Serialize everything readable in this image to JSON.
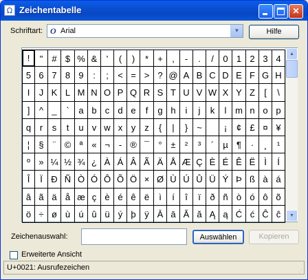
{
  "window": {
    "title": "Zeichentabelle",
    "title_icon": "charmap-icon",
    "controls": [
      "minimize",
      "maximize",
      "close"
    ]
  },
  "font": {
    "label": "Schriftart:",
    "value": "Arial",
    "type_icon": "opentype-icon"
  },
  "help_button": "Hilfe",
  "grid": {
    "rows": [
      [
        "!",
        "\"",
        "#",
        "$",
        "%",
        "&",
        "'",
        "(",
        ")",
        "*",
        "+",
        ",",
        "-",
        ".",
        "/",
        "0",
        "1",
        "2",
        "3",
        "4"
      ],
      [
        "5",
        "6",
        "7",
        "8",
        "9",
        ":",
        ";",
        "<",
        "=",
        ">",
        "?",
        "@",
        "A",
        "B",
        "C",
        "D",
        "E",
        "F",
        "G",
        "H"
      ],
      [
        "I",
        "J",
        "K",
        "L",
        "M",
        "N",
        "O",
        "P",
        "Q",
        "R",
        "S",
        "T",
        "U",
        "V",
        "W",
        "X",
        "Y",
        "Z",
        "[",
        "\\"
      ],
      [
        "]",
        "^",
        "_",
        "`",
        "a",
        "b",
        "c",
        "d",
        "e",
        "f",
        "g",
        "h",
        "i",
        "j",
        "k",
        "l",
        "m",
        "n",
        "o",
        "p"
      ],
      [
        "q",
        "r",
        "s",
        "t",
        "u",
        "v",
        "w",
        "x",
        "y",
        "z",
        "{",
        "|",
        "}",
        "~",
        " ",
        "¡",
        "¢",
        "£",
        "¤",
        "¥"
      ],
      [
        "¦",
        "§",
        "¨",
        "©",
        "ª",
        "«",
        "¬",
        "-",
        "®",
        "¯",
        "°",
        "±",
        "²",
        "³",
        "´",
        "µ",
        "¶",
        "·",
        "¸",
        "¹"
      ],
      [
        "º",
        "»",
        "¼",
        "½",
        "¾",
        "¿",
        "À",
        "Á",
        "Â",
        "Ã",
        "Ä",
        "Å",
        "Æ",
        "Ç",
        "È",
        "É",
        "Ê",
        "Ë",
        "Ì",
        "Í"
      ],
      [
        "Î",
        "Ï",
        "Ð",
        "Ñ",
        "Ò",
        "Ó",
        "Ô",
        "Õ",
        "Ö",
        "×",
        "Ø",
        "Ù",
        "Ú",
        "Û",
        "Ü",
        "Ý",
        "Þ",
        "ß",
        "à",
        "á"
      ],
      [
        "â",
        "ã",
        "ä",
        "å",
        "æ",
        "ç",
        "è",
        "é",
        "ê",
        "ë",
        "ì",
        "í",
        "î",
        "ï",
        "ð",
        "ñ",
        "ò",
        "ó",
        "ô",
        "õ"
      ],
      [
        "ö",
        "÷",
        "ø",
        "ù",
        "ú",
        "û",
        "ü",
        "ý",
        "þ",
        "ÿ",
        "Ā",
        "ā",
        "Ă",
        "ă",
        "Ą",
        "ą",
        "Ć",
        "ć",
        "Ĉ",
        "ĉ"
      ]
    ],
    "selected": "!"
  },
  "selection": {
    "label": "Zeichenauswahl:",
    "value": "",
    "select_button": "Auswählen",
    "copy_button": "Kopieren"
  },
  "advanced_view": {
    "label": "Erweiterte Ansicht",
    "checked": false
  },
  "status": "U+0021: Ausrufezeichen"
}
